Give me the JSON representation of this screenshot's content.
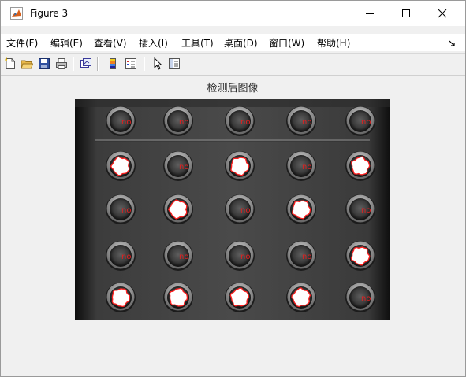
{
  "window": {
    "title": "Figure 3",
    "icon": "matlab-icon",
    "controls": [
      "minimize-icon",
      "maximize-icon",
      "close-icon"
    ]
  },
  "menubar": {
    "items": [
      {
        "label": "文件(F)"
      },
      {
        "label": "编辑(E)"
      },
      {
        "label": "查看(V)"
      },
      {
        "label": "插入(I)"
      },
      {
        "label": "工具(T)"
      },
      {
        "label": "桌面(D)"
      },
      {
        "label": "窗口(W)"
      },
      {
        "label": "帮助(H)"
      }
    ],
    "dock_arrow": "dock-arrow-icon"
  },
  "toolbar": {
    "buttons": [
      {
        "icon": "new-figure-icon"
      },
      {
        "icon": "open-file-icon"
      },
      {
        "icon": "save-icon"
      },
      {
        "icon": "print-icon"
      },
      {
        "icon": "link-plot-icon"
      },
      {
        "icon": "colorbar-icon"
      },
      {
        "icon": "legend-icon"
      },
      {
        "icon": "pointer-icon"
      },
      {
        "icon": "property-inspector-icon"
      }
    ]
  },
  "axes": {
    "title": "检测后图像"
  },
  "image": {
    "rows": 5,
    "columns": 5,
    "label_text": "no",
    "label_color": "#e02020",
    "contour_color": "#ff2020",
    "wells": [
      [
        {
          "filled": false,
          "label": "no"
        },
        {
          "filled": false,
          "label": "no"
        },
        {
          "filled": false,
          "label": "no"
        },
        {
          "filled": false,
          "label": "no"
        },
        {
          "filled": false,
          "label": "no"
        }
      ],
      [
        {
          "filled": true,
          "label": ""
        },
        {
          "filled": false,
          "label": "no"
        },
        {
          "filled": true,
          "label": ""
        },
        {
          "filled": false,
          "label": "no"
        },
        {
          "filled": true,
          "label": ""
        }
      ],
      [
        {
          "filled": false,
          "label": "no"
        },
        {
          "filled": true,
          "label": ""
        },
        {
          "filled": false,
          "label": "no"
        },
        {
          "filled": true,
          "label": ""
        },
        {
          "filled": false,
          "label": "no"
        }
      ],
      [
        {
          "filled": false,
          "label": "no"
        },
        {
          "filled": false,
          "label": "no"
        },
        {
          "filled": false,
          "label": "no"
        },
        {
          "filled": false,
          "label": "no"
        },
        {
          "filled": true,
          "label": ""
        }
      ],
      [
        {
          "filled": true,
          "label": ""
        },
        {
          "filled": true,
          "label": ""
        },
        {
          "filled": true,
          "label": ""
        },
        {
          "filled": true,
          "label": ""
        },
        {
          "filled": false,
          "label": "no"
        }
      ]
    ]
  }
}
